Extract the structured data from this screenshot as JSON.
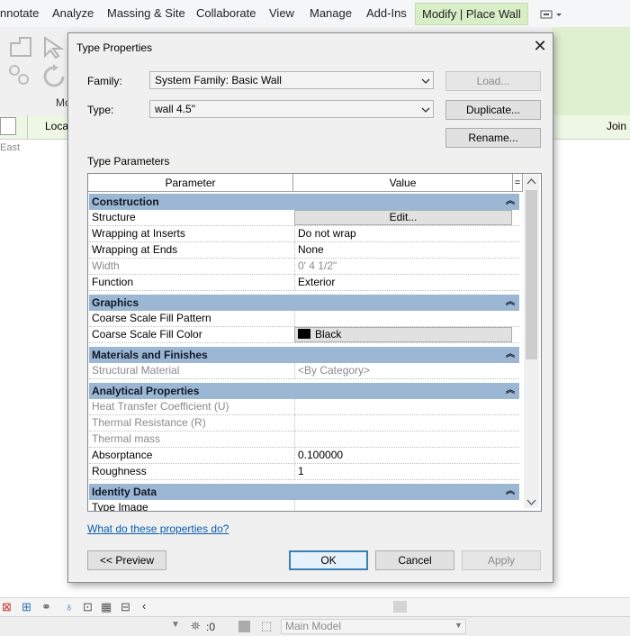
{
  "ribbon": {
    "tabs": [
      "nnotate",
      "Analyze",
      "Massing & Site",
      "Collaborate",
      "View",
      "Manage",
      "Add-Ins",
      "Modify | Place Wall"
    ],
    "active_tab": "Modify | Place Wall",
    "panel_label": "Mo"
  },
  "options_bar": {
    "location_label": "Loca",
    "join_label": "Join"
  },
  "view": {
    "east_label": "East"
  },
  "dialog": {
    "title": "Type Properties",
    "family_label": "Family:",
    "family_value": "System Family: Basic Wall",
    "type_label": "Type:",
    "type_value": "wall 4.5\"",
    "load_button": "Load...",
    "duplicate_button": "Duplicate...",
    "rename_button": "Rename...",
    "type_parameters_label": "Type Parameters",
    "table": {
      "col_parameter": "Parameter",
      "col_value": "Value",
      "col_eq": "=",
      "groups": [
        {
          "name": "Construction",
          "rows": [
            {
              "parameter": "Structure",
              "value": "Edit...",
              "kind": "button"
            },
            {
              "parameter": "Wrapping at Inserts",
              "value": "Do not wrap"
            },
            {
              "parameter": "Wrapping at Ends",
              "value": "None"
            },
            {
              "parameter": "Width",
              "value": "0'  4 1/2\"",
              "disabled": true
            },
            {
              "parameter": "Function",
              "value": "Exterior"
            }
          ]
        },
        {
          "name": "Graphics",
          "rows": [
            {
              "parameter": "Coarse Scale Fill Pattern",
              "value": ""
            },
            {
              "parameter": "Coarse Scale Fill Color",
              "value": "Black",
              "kind": "color"
            }
          ]
        },
        {
          "name": "Materials and Finishes",
          "rows": [
            {
              "parameter": "Structural Material",
              "value": "<By Category>",
              "disabled": true
            }
          ]
        },
        {
          "name": "Analytical Properties",
          "rows": [
            {
              "parameter": "Heat Transfer Coefficient (U)",
              "value": "",
              "disabled": true
            },
            {
              "parameter": "Thermal Resistance (R)",
              "value": "",
              "disabled": true
            },
            {
              "parameter": "Thermal mass",
              "value": "",
              "disabled": true
            },
            {
              "parameter": "Absorptance",
              "value": "0.100000"
            },
            {
              "parameter": "Roughness",
              "value": "1"
            }
          ]
        },
        {
          "name": "Identity Data",
          "rows": [
            {
              "parameter": "Type Image",
              "value": ""
            }
          ]
        }
      ]
    },
    "help_link": "What do these properties do?",
    "preview_button": "<< Preview",
    "ok_button": "OK",
    "cancel_button": "Cancel",
    "apply_button": "Apply"
  },
  "status_bar": {
    "zoom_value": ":0",
    "model_value": "Main Model"
  },
  "colors": {
    "group_header": "#9cb7d4",
    "active_tab": "#d8eec7",
    "link": "#0b5cad",
    "swatch": "#000000"
  }
}
